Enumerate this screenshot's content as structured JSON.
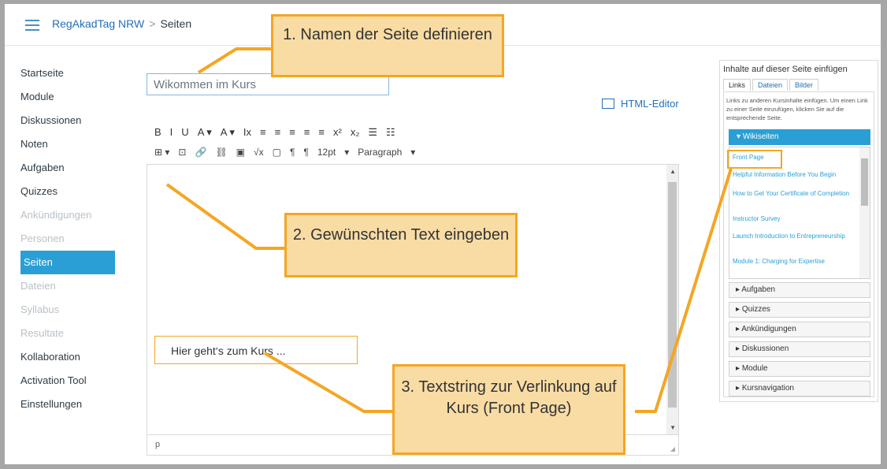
{
  "breadcrumb": {
    "course": "RegAkadTag NRW",
    "sep": ">",
    "page": "Seiten"
  },
  "nav": [
    {
      "label": "Startseite",
      "state": "normal"
    },
    {
      "label": "Module",
      "state": "normal"
    },
    {
      "label": "Diskussionen",
      "state": "normal"
    },
    {
      "label": "Noten",
      "state": "normal"
    },
    {
      "label": "Aufgaben",
      "state": "normal"
    },
    {
      "label": "Quizzes",
      "state": "normal"
    },
    {
      "label": "Ankündigungen",
      "state": "dim"
    },
    {
      "label": "Personen",
      "state": "dim"
    },
    {
      "label": "Seiten",
      "state": "active"
    },
    {
      "label": "Dateien",
      "state": "dim"
    },
    {
      "label": "Syllabus",
      "state": "dim"
    },
    {
      "label": "Resultate",
      "state": "dim"
    },
    {
      "label": "Kollaboration",
      "state": "normal"
    },
    {
      "label": "Activation Tool",
      "state": "normal"
    },
    {
      "label": "Einstellungen",
      "state": "normal"
    }
  ],
  "title_field": {
    "value": "Wikommen im Kurs"
  },
  "html_editor": "HTML-Editor",
  "toolbar": {
    "row1": [
      "B",
      "I",
      "U",
      "A ▾",
      "A ▾",
      "Ix",
      "≡",
      "≡",
      "≡",
      "≡",
      "≡",
      "x²",
      "x₂",
      "☰",
      "☷"
    ],
    "row2": [
      "⊞ ▾",
      "⊡",
      "🔗",
      "⛓",
      "▣",
      "√x",
      "▢",
      "¶",
      "¶",
      "12pt",
      "▾",
      "Paragraph",
      "▾"
    ]
  },
  "editor": {
    "link_text": "Hier geht‘s zum Kurs ...",
    "status_path": "p"
  },
  "right_panel": {
    "title": "Inhalte auf dieser Seite einfügen",
    "tabs": [
      "Links",
      "Dateien",
      "Bilder"
    ],
    "description": "Links zu anderen Kursinhalte einfügen. Um einen Link zu einer Seite einzufügen, klicken Sie auf die entsprechende Seite.",
    "wiki_header": "Wikiseiten",
    "wiki_items": [
      "Front Page",
      "Helpful Information Before You Begin",
      "How to Get Your Certificate of Completion",
      "Instructor Survey",
      "Launch Introduction to Entrepreneurship",
      "Module 1: Charging for Expertise"
    ],
    "sections": [
      "Aufgaben",
      "Quizzes",
      "Ankündigungen",
      "Diskussionen",
      "Module",
      "Kursnavigation"
    ]
  },
  "callouts": {
    "c1": "1. Namen der Seite definieren",
    "c2": "2. Gewünschten Text eingeben",
    "c3": "3. Textstring zur Verlinkung auf Kurs (Front Page)"
  },
  "colors": {
    "accent": "#2a9fd6",
    "callout_fill": "#f9dca4",
    "callout_border": "#f4a623",
    "link": "#2270b8"
  }
}
